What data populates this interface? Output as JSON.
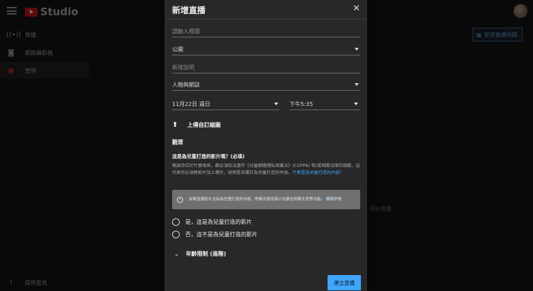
{
  "app": {
    "brand": "Studio"
  },
  "sidebar": {
    "items": [
      {
        "label": "直播",
        "icon": "live-icon"
      },
      {
        "label": "網路攝影機",
        "icon": "camera-icon"
      },
      {
        "label": "管理",
        "icon": "calendar-icon"
      }
    ],
    "feedback_label": "提供意見"
  },
  "header": {
    "schedule_label": "安排直播時間"
  },
  "background_hint": "開始直播",
  "modal": {
    "title": "新增直播",
    "title_placeholder": "請輸入標題",
    "visibility": "公開",
    "description_placeholder": "新增說明",
    "category": "人物與網誌",
    "date": "11月22日 週日",
    "time": "下午5:35",
    "upload_thumbnail": "上傳自訂縮圖",
    "audience": {
      "section_title": "觀眾",
      "question": "這是為兒童打造的影片嗎？(必填)",
      "description": "無論你位於什麼地區，都必須依法遵守《兒童網路隱私保護法》(COPPA) 和/或相關法律的規範。這代表你必須替影片加上標示，說明是否屬於為兒童打造的內容。",
      "description_link": "什麼是為兒童打造的內容？",
      "notice": "如果直播影片含有為兒童打造的內容，則無法使用個人化廣告和聊天室等功能。",
      "notice_link": "瞭解詳情",
      "option_yes": "是，這是為兒童打造的影片",
      "option_no": "否，這不是為兒童打造的影片"
    },
    "age_restriction": "年齡限制 (進階)",
    "create_button": "建立直播"
  },
  "colors": {
    "accent": "#3ea6ff",
    "brand_red": "#b31217"
  }
}
